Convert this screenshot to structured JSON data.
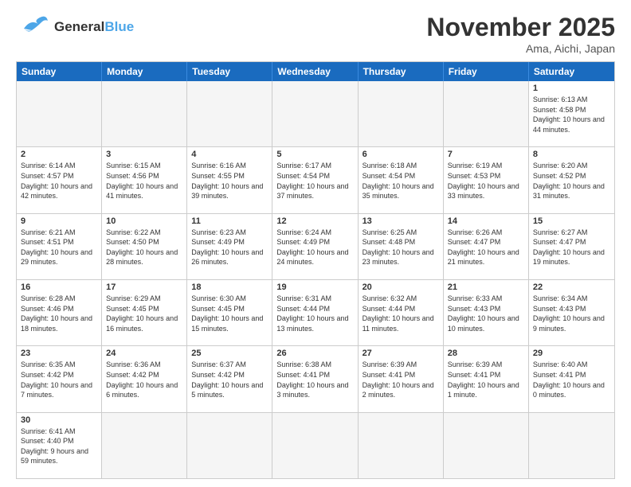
{
  "header": {
    "logo_general": "General",
    "logo_blue": "Blue",
    "month_title": "November 2025",
    "location": "Ama, Aichi, Japan"
  },
  "weekdays": [
    "Sunday",
    "Monday",
    "Tuesday",
    "Wednesday",
    "Thursday",
    "Friday",
    "Saturday"
  ],
  "weeks": [
    [
      {
        "day": "",
        "empty": true
      },
      {
        "day": "",
        "empty": true
      },
      {
        "day": "",
        "empty": true
      },
      {
        "day": "",
        "empty": true
      },
      {
        "day": "",
        "empty": true
      },
      {
        "day": "",
        "empty": true
      },
      {
        "day": "1",
        "sunrise": "6:13 AM",
        "sunset": "4:58 PM",
        "daylight": "10 hours and 44 minutes."
      }
    ],
    [
      {
        "day": "2",
        "sunrise": "6:14 AM",
        "sunset": "4:57 PM",
        "daylight": "10 hours and 42 minutes."
      },
      {
        "day": "3",
        "sunrise": "6:15 AM",
        "sunset": "4:56 PM",
        "daylight": "10 hours and 41 minutes."
      },
      {
        "day": "4",
        "sunrise": "6:16 AM",
        "sunset": "4:55 PM",
        "daylight": "10 hours and 39 minutes."
      },
      {
        "day": "5",
        "sunrise": "6:17 AM",
        "sunset": "4:54 PM",
        "daylight": "10 hours and 37 minutes."
      },
      {
        "day": "6",
        "sunrise": "6:18 AM",
        "sunset": "4:54 PM",
        "daylight": "10 hours and 35 minutes."
      },
      {
        "day": "7",
        "sunrise": "6:19 AM",
        "sunset": "4:53 PM",
        "daylight": "10 hours and 33 minutes."
      },
      {
        "day": "8",
        "sunrise": "6:20 AM",
        "sunset": "4:52 PM",
        "daylight": "10 hours and 31 minutes."
      }
    ],
    [
      {
        "day": "9",
        "sunrise": "6:21 AM",
        "sunset": "4:51 PM",
        "daylight": "10 hours and 29 minutes."
      },
      {
        "day": "10",
        "sunrise": "6:22 AM",
        "sunset": "4:50 PM",
        "daylight": "10 hours and 28 minutes."
      },
      {
        "day": "11",
        "sunrise": "6:23 AM",
        "sunset": "4:49 PM",
        "daylight": "10 hours and 26 minutes."
      },
      {
        "day": "12",
        "sunrise": "6:24 AM",
        "sunset": "4:49 PM",
        "daylight": "10 hours and 24 minutes."
      },
      {
        "day": "13",
        "sunrise": "6:25 AM",
        "sunset": "4:48 PM",
        "daylight": "10 hours and 23 minutes."
      },
      {
        "day": "14",
        "sunrise": "6:26 AM",
        "sunset": "4:47 PM",
        "daylight": "10 hours and 21 minutes."
      },
      {
        "day": "15",
        "sunrise": "6:27 AM",
        "sunset": "4:47 PM",
        "daylight": "10 hours and 19 minutes."
      }
    ],
    [
      {
        "day": "16",
        "sunrise": "6:28 AM",
        "sunset": "4:46 PM",
        "daylight": "10 hours and 18 minutes."
      },
      {
        "day": "17",
        "sunrise": "6:29 AM",
        "sunset": "4:45 PM",
        "daylight": "10 hours and 16 minutes."
      },
      {
        "day": "18",
        "sunrise": "6:30 AM",
        "sunset": "4:45 PM",
        "daylight": "10 hours and 15 minutes."
      },
      {
        "day": "19",
        "sunrise": "6:31 AM",
        "sunset": "4:44 PM",
        "daylight": "10 hours and 13 minutes."
      },
      {
        "day": "20",
        "sunrise": "6:32 AM",
        "sunset": "4:44 PM",
        "daylight": "10 hours and 11 minutes."
      },
      {
        "day": "21",
        "sunrise": "6:33 AM",
        "sunset": "4:43 PM",
        "daylight": "10 hours and 10 minutes."
      },
      {
        "day": "22",
        "sunrise": "6:34 AM",
        "sunset": "4:43 PM",
        "daylight": "10 hours and 9 minutes."
      }
    ],
    [
      {
        "day": "23",
        "sunrise": "6:35 AM",
        "sunset": "4:42 PM",
        "daylight": "10 hours and 7 minutes."
      },
      {
        "day": "24",
        "sunrise": "6:36 AM",
        "sunset": "4:42 PM",
        "daylight": "10 hours and 6 minutes."
      },
      {
        "day": "25",
        "sunrise": "6:37 AM",
        "sunset": "4:42 PM",
        "daylight": "10 hours and 5 minutes."
      },
      {
        "day": "26",
        "sunrise": "6:38 AM",
        "sunset": "4:41 PM",
        "daylight": "10 hours and 3 minutes."
      },
      {
        "day": "27",
        "sunrise": "6:39 AM",
        "sunset": "4:41 PM",
        "daylight": "10 hours and 2 minutes."
      },
      {
        "day": "28",
        "sunrise": "6:39 AM",
        "sunset": "4:41 PM",
        "daylight": "10 hours and 1 minute."
      },
      {
        "day": "29",
        "sunrise": "6:40 AM",
        "sunset": "4:41 PM",
        "daylight": "10 hours and 0 minutes."
      }
    ],
    [
      {
        "day": "30",
        "sunrise": "6:41 AM",
        "sunset": "4:40 PM",
        "daylight": "9 hours and 59 minutes."
      },
      {
        "day": "",
        "empty": true
      },
      {
        "day": "",
        "empty": true
      },
      {
        "day": "",
        "empty": true
      },
      {
        "day": "",
        "empty": true
      },
      {
        "day": "",
        "empty": true
      },
      {
        "day": "",
        "empty": true
      }
    ]
  ]
}
